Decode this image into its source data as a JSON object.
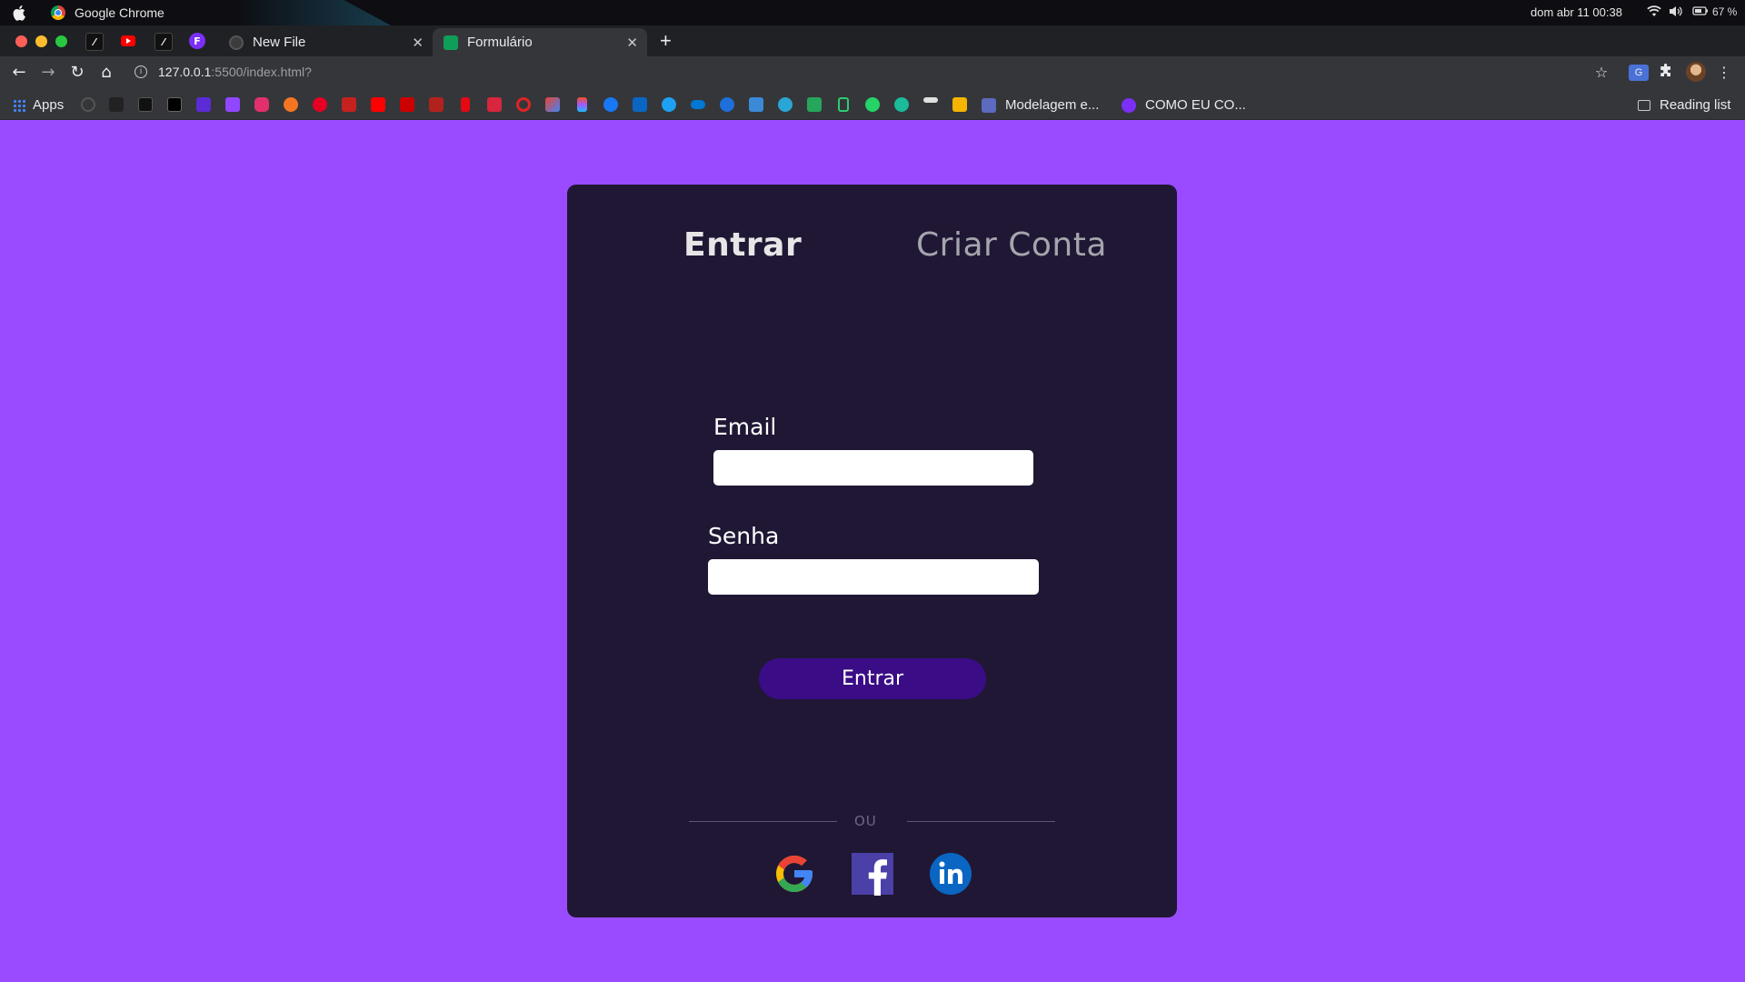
{
  "os": {
    "app_name": "Google Chrome",
    "clock": "dom abr 11  00:38",
    "battery": "67 %"
  },
  "browser": {
    "tabs": [
      {
        "title": "New File",
        "active": false
      },
      {
        "title": "Formulário",
        "active": true
      }
    ],
    "url_host": "127.0.0.1",
    "url_path": ":5500/index.html?",
    "bookmarks": {
      "apps_label": "Apps",
      "modelagem": "Modelagem e...",
      "como_eu": "COMO EU CO...",
      "reading_list": "Reading list"
    }
  },
  "form": {
    "tab_login": "Entrar",
    "tab_signup": "Criar Conta",
    "email_label": "Email",
    "email_value": "",
    "password_label": "Senha",
    "password_value": "",
    "submit_label": "Entrar",
    "divider_text": "OU"
  },
  "colors": {
    "page_background": "#9a4bff",
    "card_background": "#201735",
    "button_background": "#3a0c86",
    "google_red": "#ea4335",
    "google_yellow": "#fbbc05",
    "google_green": "#34a853",
    "google_blue": "#4285f4",
    "facebook": "#4b3fa8",
    "linkedin": "#0a66c2"
  },
  "social_icons": [
    "google-icon",
    "facebook-icon",
    "linkedin-icon"
  ]
}
